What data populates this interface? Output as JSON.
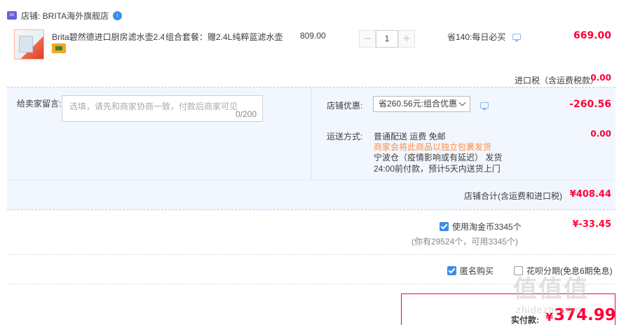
{
  "store": {
    "icon_text": "tm",
    "label": "店铺: BRITA海外旗舰店",
    "badge": "i"
  },
  "item": {
    "title": "Brita碧然德进口厨房滤水壶2.4...",
    "sku": "组合套餐：赠2.4L纯粹蓝滤水壶",
    "unit_price": "809.00",
    "quantity": "1",
    "minus": "−",
    "plus": "+",
    "promo_note": "省140:每日必买",
    "total": "669.00"
  },
  "tax": {
    "label": "进口税（含运费税款）",
    "value": "0.00"
  },
  "message": {
    "label": "给卖家留言:",
    "placeholder": "选填，请先和商家协商一致，付款后商家可见",
    "counter": "0/200"
  },
  "store_promo": {
    "label": "店铺优惠:",
    "selected": "省260.56元:组合优惠",
    "value": "-260.56"
  },
  "shipping": {
    "label": "运送方式:",
    "method": "普通配送 运费 免邮",
    "note": "商家会将此商品以独立包裹发货",
    "warehouse": "宁波仓（疫情影响或有延迟）   发货",
    "eta": "24:00前付款，预计5天内送货上门",
    "value": "0.00"
  },
  "subtotal": {
    "label": "店铺合计(含运费和进口税)",
    "value": "¥408.44"
  },
  "coins": {
    "label": "使用淘金币3345个",
    "sub": "(你有29524个，可用3345个)",
    "value": "¥-33.45"
  },
  "options": {
    "anonymous": "匿名购买",
    "installment": "花呗分期(免息6期免息)"
  },
  "payment": {
    "label": "实付款:",
    "currency": "¥",
    "value": "374.99"
  },
  "watermark": {
    "logo": "值值值",
    "url": "zhidezhi.com"
  },
  "colors": {
    "accent_red": "#ff0036",
    "link_blue": "#3d8fe6",
    "panel_bg": "#f2f7ff",
    "note_orange": "#ff8b3b"
  }
}
